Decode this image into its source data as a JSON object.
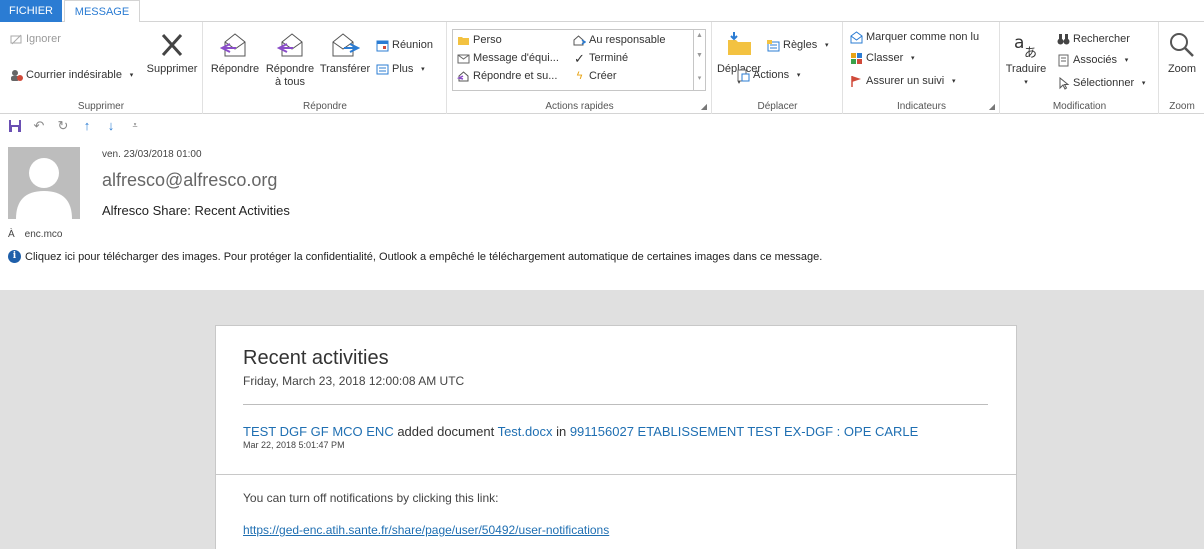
{
  "tabs": {
    "file": "FICHIER",
    "message": "MESSAGE"
  },
  "ribbon": {
    "supprimer": {
      "label": "Supprimer",
      "ignore": "Ignorer",
      "junk": "Courrier indésirable",
      "delete": "Supprimer"
    },
    "repondre": {
      "label": "Répondre",
      "reply": "Répondre",
      "reply_all_1": "Répondre",
      "reply_all_2": "à tous",
      "forward": "Transférer",
      "meeting": "Réunion",
      "more": "Plus"
    },
    "quick": {
      "label": "Actions rapides",
      "perso": "Perso",
      "team_msg": "Message d'équi...",
      "reply_delete": "Répondre et su...",
      "to_manager": "Au responsable",
      "done": "Terminé",
      "create": "Créer"
    },
    "move": {
      "label": "Déplacer",
      "move": "Déplacer",
      "rules": "Règles",
      "actions": "Actions"
    },
    "tags": {
      "label": "Indicateurs",
      "unread": "Marquer comme non lu",
      "categorize": "Classer",
      "followup": "Assurer un suivi"
    },
    "edit": {
      "label": "Modification",
      "translate": "Traduire",
      "find": "Rechercher",
      "related": "Associés",
      "select": "Sélectionner"
    },
    "zoom": {
      "label": "Zoom",
      "zoom": "Zoom"
    }
  },
  "header": {
    "date": "ven. 23/03/2018 01:00",
    "from": "alfresco@alfresco.org",
    "subject": "Alfresco Share: Recent Activities",
    "to_label": "À",
    "to": "enc.mco",
    "info": "Cliquez ici pour télécharger des images. Pour protéger la confidentialité, Outlook a empêché le téléchargement automatique de certaines images dans ce message."
  },
  "body": {
    "title": "Recent activities",
    "date": "Friday, March 23, 2018 12:00:08 AM UTC",
    "activity": {
      "user": "TEST DGF GF MCO ENC",
      "verb": " added document ",
      "document": "Test.docx",
      "prep": " in ",
      "site": "991156027 ETABLISSEMENT TEST EX-DGF : OPE CARLE",
      "time": "Mar 22, 2018 5:01:47 PM"
    },
    "notif_text": "You can turn off notifications by clicking this link:",
    "notif_link": "https://ged-enc.atih.sante.fr/share/page/user/50492/user-notifications"
  },
  "colors": {
    "accent": "#2b7cd3",
    "link": "#1f6fb2",
    "body_bg": "#e0e0e0"
  }
}
